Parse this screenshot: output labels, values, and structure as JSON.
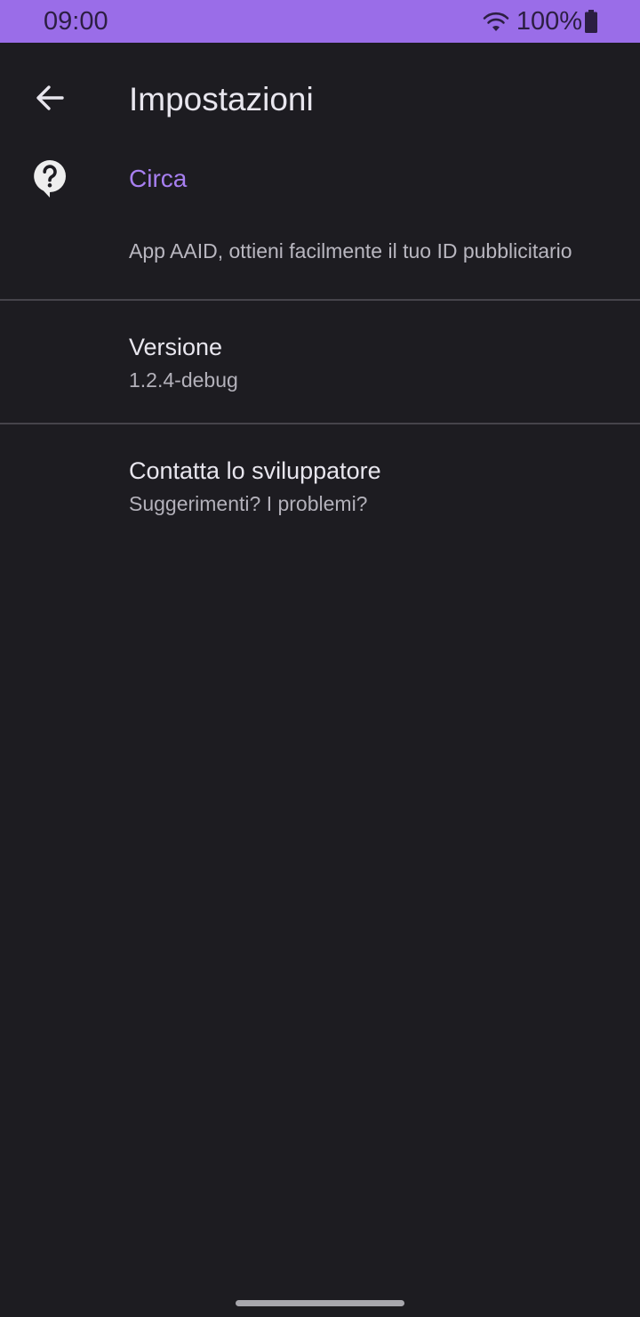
{
  "status_bar": {
    "time": "09:00",
    "battery_percent": "100%",
    "wifi_icon": "wifi-icon",
    "battery_icon": "battery-full-icon",
    "background_color": "#9a6de8"
  },
  "app_bar": {
    "title": "Impostazioni",
    "back_icon": "arrow-back-icon"
  },
  "about_section": {
    "icon": "help-bubble-icon",
    "header": "Circa",
    "description": "App AAID, ottieni facilmente il tuo ID pubblicitario",
    "accent_color": "#a77ff0"
  },
  "preferences": [
    {
      "title": "Versione",
      "summary": "1.2.4-debug"
    },
    {
      "title": "Contatta lo sviluppatore",
      "summary": "Suggerimenti? I problemi?"
    }
  ],
  "theme": {
    "background": "#1d1c21"
  }
}
